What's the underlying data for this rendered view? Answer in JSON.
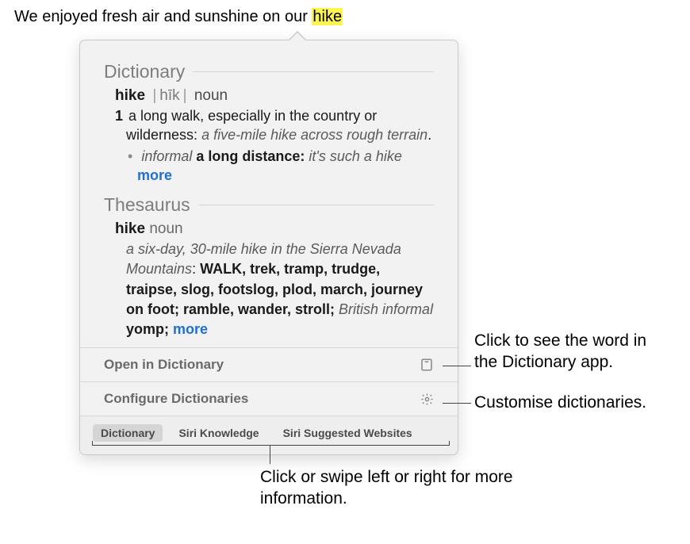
{
  "sentence": {
    "pre": "We enjoyed fresh air and sunshine on our ",
    "highlight": "hike"
  },
  "popover": {
    "dict": {
      "heading": "Dictionary",
      "word": "hike",
      "pronunciation": "hīk",
      "pos": "noun",
      "def_num": "1",
      "def_text": "a long walk, especially in the country or wilderness:",
      "def_example": "a five-mile hike across rough terrain",
      "dot": "•",
      "sub_label": "informal",
      "sub_text": "a long distance:",
      "sub_example": "it's such a hike",
      "more": "more"
    },
    "thes": {
      "heading": "Thesaurus",
      "word": "hike",
      "pos": "noun",
      "example": "a six-day, 30-mile hike in the Sierra Nevada Mountains",
      "caps": "WALK",
      "synonyms": ", trek, tramp, trudge, traipse, slog, footslog, plod, march, journey on foot; ramble, wander, stroll; ",
      "label": "British informal",
      "tail": " yomp;",
      "more": "more"
    },
    "open_row": "Open in Dictionary",
    "config_row": "Configure Dictionaries",
    "icons": {
      "open": "dictionary-app-icon",
      "config": "gear-icon"
    },
    "tabs": {
      "dictionary": "Dictionary",
      "siri": "Siri Knowledge",
      "web": "Siri Suggested Websites"
    }
  },
  "callouts": {
    "open": "Click to see the word in the Dictionary app.",
    "config": "Customise dictionaries.",
    "tabs": "Click or swipe left or right for more information."
  }
}
